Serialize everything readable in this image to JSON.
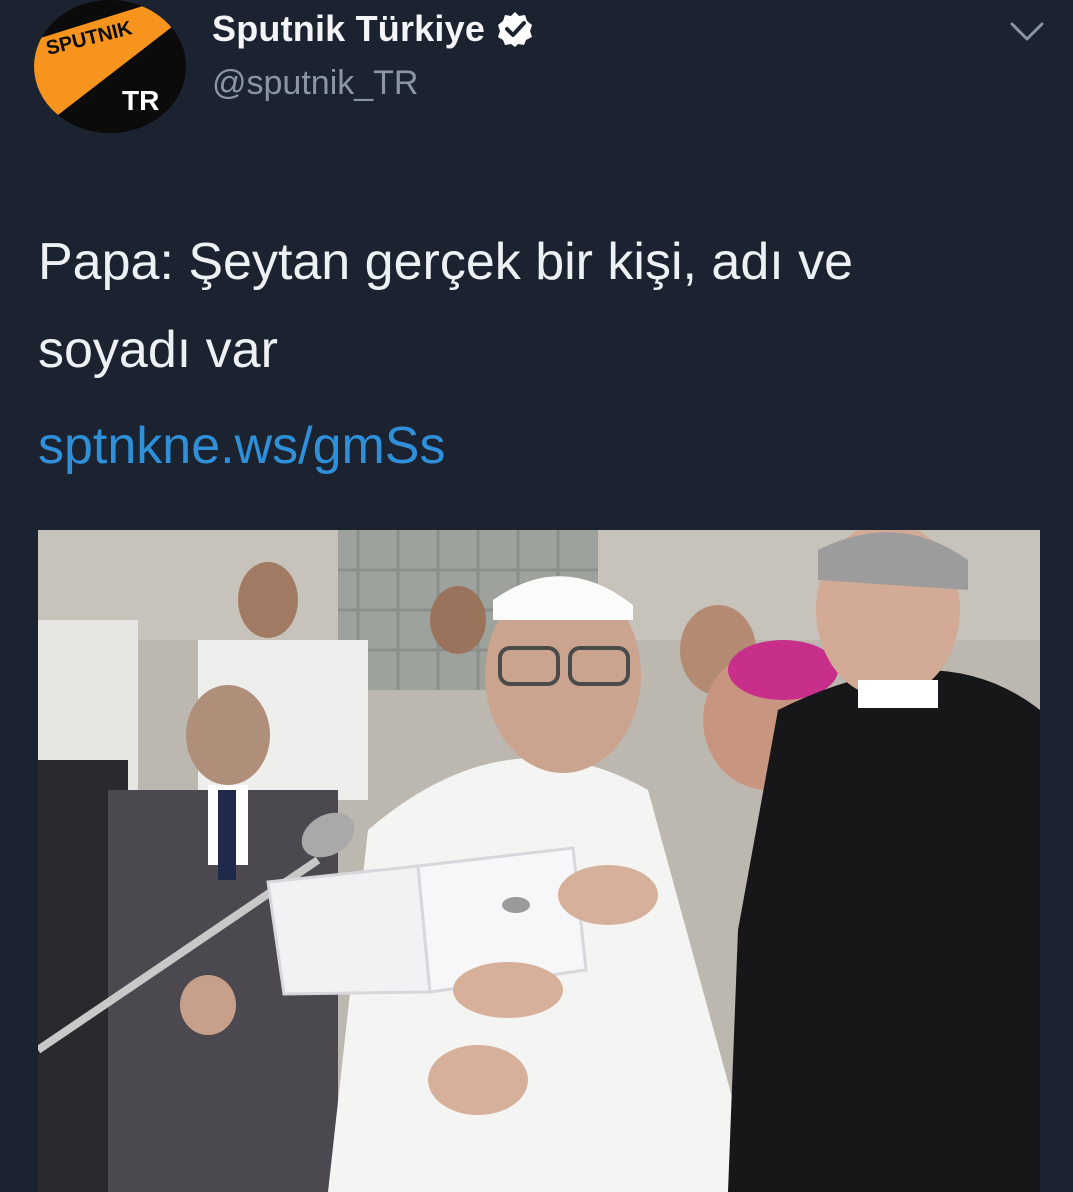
{
  "tweet": {
    "display_name": "Sputnik Türkiye",
    "handle": "@sputnik_TR",
    "verified": true,
    "avatar": {
      "logo_text": "SPUTNIK",
      "badge_text": "TR",
      "accent": "#f7941d"
    },
    "text_line1": "Papa: Şeytan gerçek bir kişi, adı ve",
    "text_line2": "soyadı var",
    "link": "sptnkne.ws/gmSs",
    "menu_icon": "chevron-down-icon",
    "media_icon": "photo"
  },
  "colors": {
    "background": "#1b2330",
    "text": "#eef1f4",
    "handle": "#8a96a3",
    "link": "#2f8fd8",
    "verified": "#ffffff"
  }
}
